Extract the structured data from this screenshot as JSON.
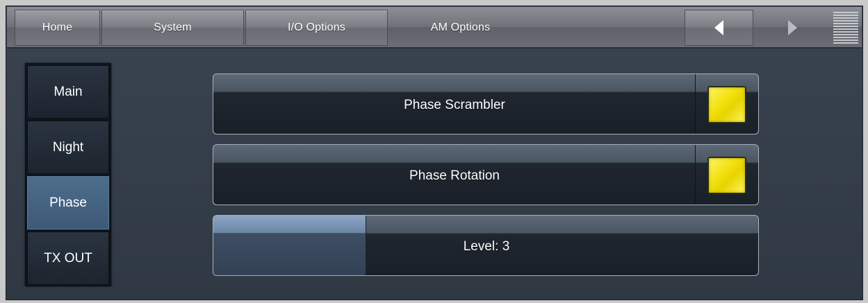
{
  "nav": {
    "tabs": [
      {
        "label": "Home"
      },
      {
        "label": "System"
      },
      {
        "label": "I/O Options"
      },
      {
        "label": "AM Options"
      }
    ],
    "back_icon": "chevron-left-icon",
    "forward_icon": "chevron-right-icon",
    "menu_icon": "menu-lines-icon"
  },
  "sidebar": {
    "items": [
      {
        "label": "Main",
        "active": false
      },
      {
        "label": "Night",
        "active": false
      },
      {
        "label": "Phase",
        "active": true
      },
      {
        "label": "TX OUT",
        "active": false
      }
    ]
  },
  "controls": {
    "phase_scrambler": {
      "label": "Phase Scrambler",
      "enabled": true
    },
    "phase_rotation": {
      "label": "Phase Rotation",
      "enabled": true
    },
    "level": {
      "label": "Level: 3",
      "fill_fraction": 0.28
    }
  },
  "colors": {
    "toggle_on": "#f3e210",
    "active_tab": "#4d6d8c"
  }
}
